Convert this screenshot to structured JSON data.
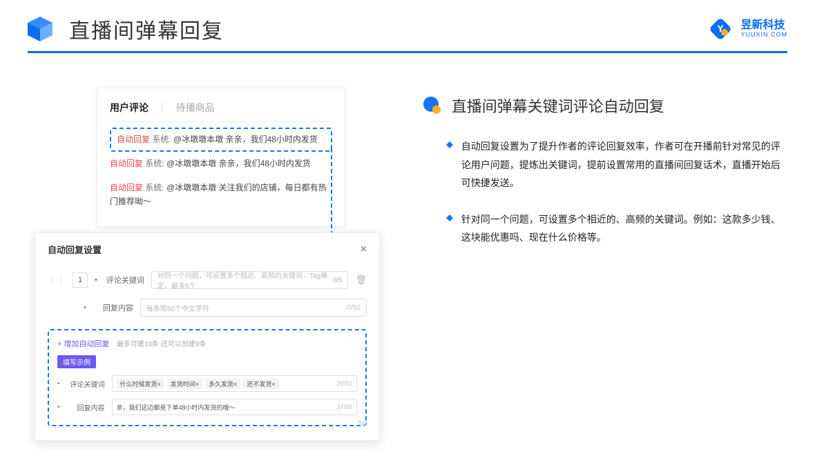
{
  "header": {
    "title": "直播间弹幕回复",
    "logo_cn": "昱新科技",
    "logo_en": "YUUXIN.COM"
  },
  "panels": {
    "comments": {
      "tab_active": "用户评论",
      "tab_inactive": "待播商品",
      "tag": "自动回复",
      "sys": "系统:",
      "c1": "@冰墩墩本墩 亲亲，我们48小时内发货",
      "c2": "@冰墩墩本墩 亲亲，我们48小时内发货",
      "c3": "@冰墩墩本墩 关注我们的店铺，每日都有热门推荐呦～"
    },
    "settings": {
      "title": "自动回复设置",
      "idx": "1",
      "lab_kw": "评论关键词",
      "ph_kw": "对同一个问题，可设置多个相近、高频的关键词，Tag确定，最多5个",
      "cnt_kw": "0/5",
      "lab_ct": "回复内容",
      "ph_ct": "每条限50个中文字符",
      "cnt_ct": "0/50",
      "add": "+ 增加自动回复",
      "add_hint": "最多可建10条 还可以创建9条",
      "badge": "填写示例",
      "ex_kw_lab": "评论关键词",
      "ex_kw_tags": [
        "什么时候发货×",
        "发货时间×",
        "多久发货×",
        "还不发货×"
      ],
      "ex_kw_cnt": "20/50",
      "ex_ct_lab": "回复内容",
      "ex_ct_val": "亲，我们这边都是下单48小时内发货的哦～",
      "ex_ct_cnt": "37/50",
      "pager": "/50"
    }
  },
  "right": {
    "section_title": "直播间弹幕关键词评论自动回复",
    "b1": "自动回复设置为了提升作者的评论回复效率，作者可在开播前针对常见的评论用户问题，提炼出关键词，提前设置常用的直播间回复话术，直播开始后可快捷发送。",
    "b2": "针对同一个问题，可设置多个相近的、高频的关键词。例如：这款多少钱、这块能优惠吗、现在什么价格等。"
  }
}
